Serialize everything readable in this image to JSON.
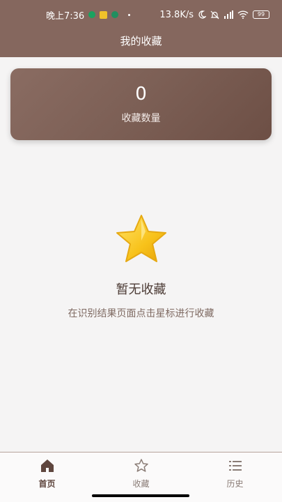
{
  "status_bar": {
    "time": "晚上7:36",
    "network_speed": "13.8K/s",
    "battery": "99",
    "network_label": "4G"
  },
  "header": {
    "title": "我的收藏"
  },
  "count_card": {
    "value": "0",
    "label": "收藏数量"
  },
  "empty_state": {
    "icon": "star-icon",
    "title": "暂无收藏",
    "subtitle": "在识别结果页面点击星标进行收藏"
  },
  "tabs": [
    {
      "label": "首页",
      "icon": "home-icon",
      "active": true
    },
    {
      "label": "收藏",
      "icon": "star-outline-icon",
      "active": false
    },
    {
      "label": "历史",
      "icon": "list-icon",
      "active": false
    }
  ],
  "colors": {
    "header_bg": "#85675e",
    "card_bg": "#7c5f55",
    "page_bg": "#f5f4f4",
    "active_tab": "#5f463e"
  }
}
